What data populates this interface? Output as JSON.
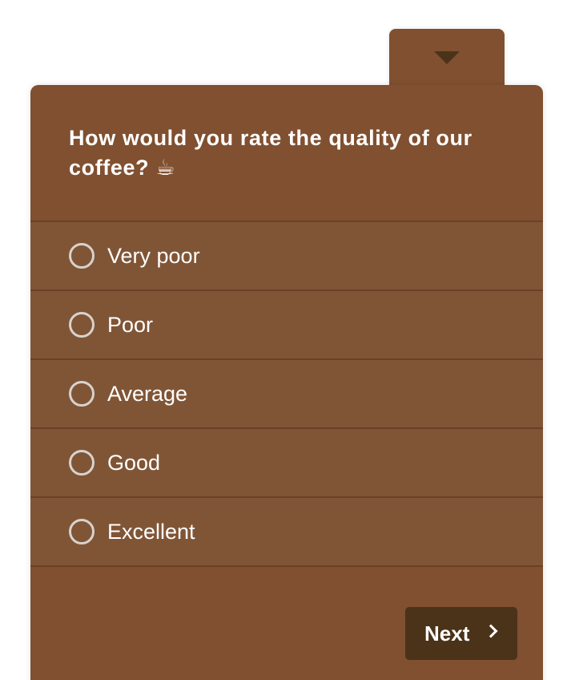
{
  "survey": {
    "question": "How would you rate the quality of our coffee? ☕",
    "options": [
      {
        "label": "Very poor",
        "selected": false
      },
      {
        "label": "Poor",
        "selected": false
      },
      {
        "label": "Average",
        "selected": false
      },
      {
        "label": "Good",
        "selected": false
      },
      {
        "label": "Excellent",
        "selected": false
      }
    ],
    "next_label": "Next",
    "icons": {
      "collapse": "chevron-down-icon",
      "next": "chevron-right-icon"
    }
  },
  "colors": {
    "card_bg": "#805030",
    "option_bg": "#805536",
    "divider": "#6a4126",
    "button_bg": "#4a3319",
    "text": "#ffffff",
    "radio_border": "#d8d2cd"
  }
}
